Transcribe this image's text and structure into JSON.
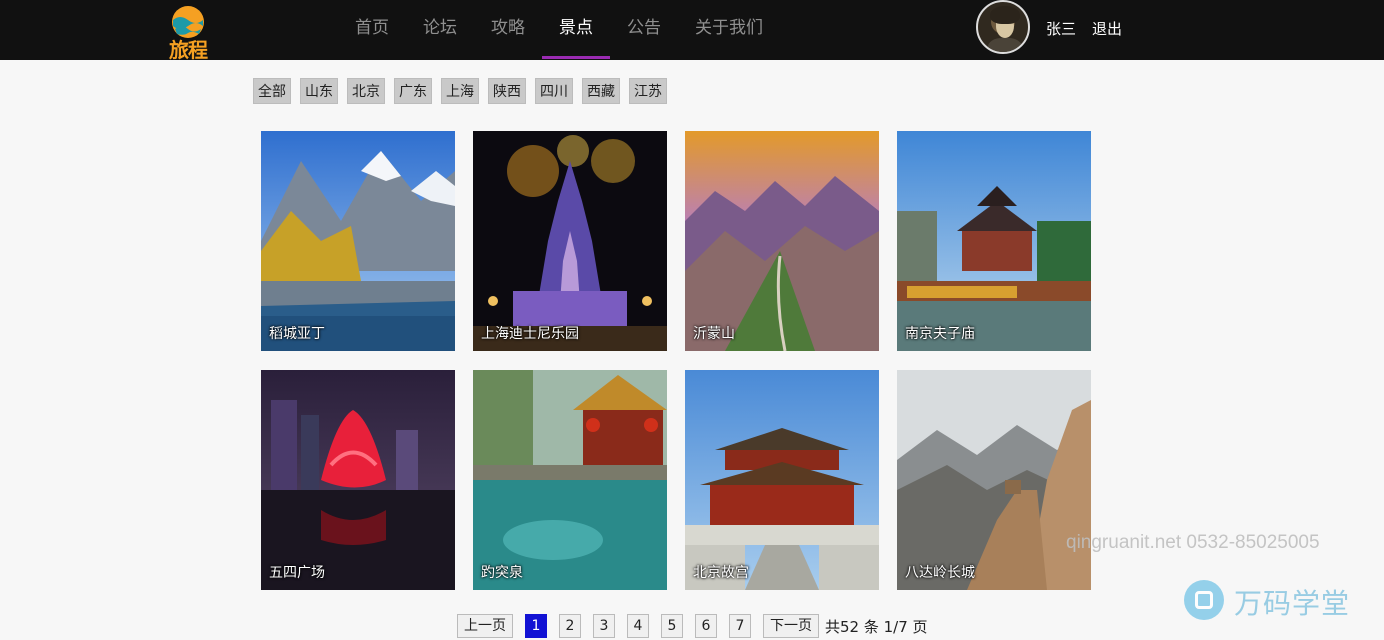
{
  "header": {
    "logo_text": "旅程",
    "nav": [
      "首页",
      "论坛",
      "攻略",
      "景点",
      "公告",
      "关于我们"
    ],
    "active_nav": "景点",
    "username": "张三",
    "logout": "退出"
  },
  "filters": [
    "全部",
    "山东",
    "北京",
    "广东",
    "上海",
    "陕西",
    "四川",
    "西藏",
    "江苏"
  ],
  "attractions": [
    {
      "name": "稻城亚丁"
    },
    {
      "name": "上海迪士尼乐园"
    },
    {
      "name": "沂蒙山"
    },
    {
      "name": "南京夫子庙"
    },
    {
      "name": "五四广场"
    },
    {
      "name": "趵突泉"
    },
    {
      "name": "北京故宫"
    },
    {
      "name": "八达岭长城"
    }
  ],
  "pagination": {
    "prev": "上一页",
    "next": "下一页",
    "pages": [
      "1",
      "2",
      "3",
      "4",
      "5",
      "6",
      "7"
    ],
    "current": "1",
    "summary": "共52 条 1/7 页"
  },
  "watermark": {
    "contact": "qingruanit.net 0532-85025005",
    "brand": "万码学堂"
  }
}
